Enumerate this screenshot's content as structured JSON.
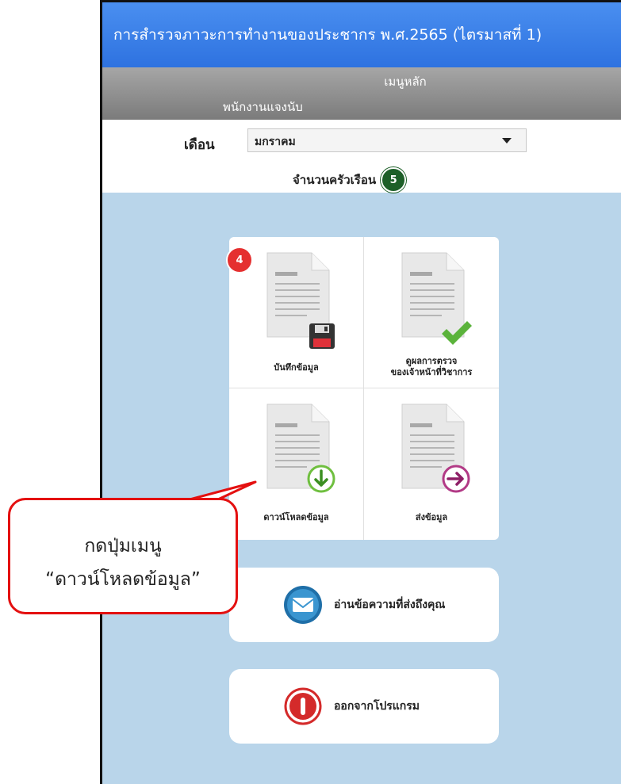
{
  "header": {
    "title": "การสำรวจภาวะการทำงานของประชากร พ.ศ.2565 (ไตรมาสที่ 1)"
  },
  "menubar": {
    "title": "เมนูหลัก",
    "role": "พนักงานแจงนับ"
  },
  "month": {
    "label": "เดือน",
    "selected": "มกราคม"
  },
  "household": {
    "label": "จำนวนครัวเรือน",
    "count": "5"
  },
  "tiles": [
    {
      "label": "บันทึกข้อมูล",
      "badge": "4",
      "icon": "save-icon"
    },
    {
      "label_line1": "ดูผลการตรวจ",
      "label_line2": "ของเจ้าหน้าที่วิชาการ",
      "icon": "check-icon"
    },
    {
      "label": "ดาวน์โหลดข้อมูล",
      "icon": "download-icon"
    },
    {
      "label": "ส่งข้อมูล",
      "icon": "send-icon"
    }
  ],
  "messages": {
    "label": "อ่านข้อความที่ส่งถึงคุณ",
    "icon": "mail-icon"
  },
  "exit": {
    "label": "ออกจากโปรแกรม",
    "icon": "power-icon"
  },
  "callout": {
    "line1": "กดปุ่มเมนู",
    "line2": "“ดาวน์โหลดข้อมูล”"
  },
  "colors": {
    "title": "#2e72e0",
    "background": "#b9d5ea",
    "badge_red": "#e53030",
    "badge_green": "#1d5f28",
    "callout_border": "#e41010"
  }
}
